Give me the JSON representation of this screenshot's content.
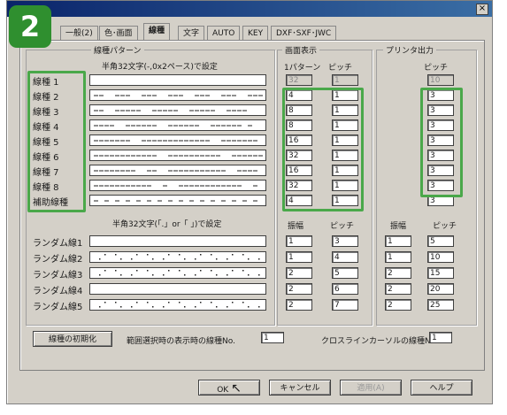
{
  "step_badge": "2",
  "close_glyph": "×",
  "tabs": [
    "一般(2)",
    "色･画面",
    "線種",
    "文字",
    "AUTO",
    "KEY",
    "DXF･SXF･JWC"
  ],
  "active_tab": 2,
  "line_type": {
    "group_title": "線種パターン",
    "pattern_note": "半角32文字(-,0x2ペース)で設定",
    "rows": [
      "線種 1",
      "線種 2",
      "線種 3",
      "線種 4",
      "線種 5",
      "線種 6",
      "線種 7",
      "線種 8",
      "補助線種"
    ]
  },
  "screen_display": {
    "group_title": "画面表示",
    "col1": "1パターン",
    "col2": "ピッチ",
    "values": [
      [
        "32",
        "1"
      ],
      [
        "4",
        "1"
      ],
      [
        "8",
        "1"
      ],
      [
        "8",
        "1"
      ],
      [
        "16",
        "1"
      ],
      [
        "32",
        "1"
      ],
      [
        "16",
        "1"
      ],
      [
        "32",
        "1"
      ],
      [
        "4",
        "1"
      ]
    ]
  },
  "printer_output": {
    "group_title": "プリンタ出力",
    "col": "ピッチ",
    "values": [
      "10",
      "3",
      "3",
      "3",
      "3",
      "3",
      "3",
      "3",
      "3"
    ]
  },
  "random_line": {
    "pattern_note": "半角32文字(「.」or「 」)で設定",
    "rows": [
      "ランダム線1",
      "ランダム線2",
      "ランダム線3",
      "ランダム線4",
      "ランダム線5"
    ],
    "screen_col1": "振幅",
    "screen_col2": "ピッチ",
    "screen_values": [
      [
        "1",
        "3"
      ],
      [
        "1",
        "4"
      ],
      [
        "2",
        "5"
      ],
      [
        "2",
        "6"
      ],
      [
        "2",
        "7"
      ]
    ],
    "printer_col1": "振幅",
    "printer_col2": "ピッチ",
    "printer_values": [
      [
        "1",
        "5"
      ],
      [
        "1",
        "10"
      ],
      [
        "2",
        "15"
      ],
      [
        "2",
        "20"
      ],
      [
        "2",
        "25"
      ]
    ]
  },
  "bottom": {
    "init_button": "線種の初期化",
    "range_label": "範囲選択時の表示時の線種No.",
    "range_value": "1",
    "cursor_label": "クロスラインカーソルの線種No.",
    "cursor_value": "1"
  },
  "footer": {
    "ok": "OK",
    "cancel": "キャンセル",
    "apply": "適用(A)",
    "help": "ヘルプ"
  },
  "highlight_color": "#4aa84a"
}
